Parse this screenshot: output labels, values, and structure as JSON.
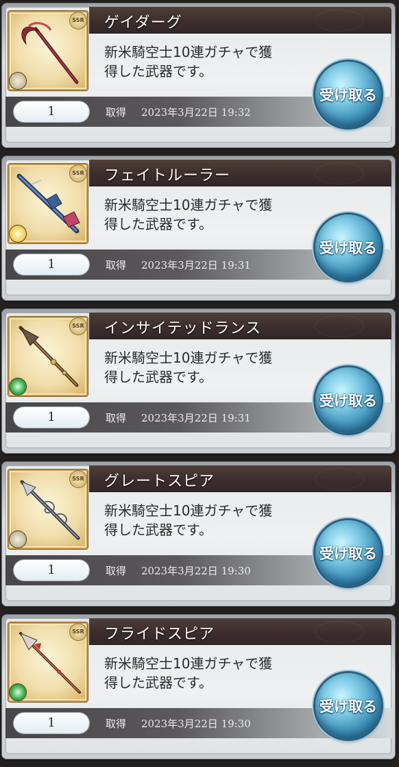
{
  "colors": {
    "title_bar": "#3b2d2a",
    "receive_button": "#3d8fb7",
    "element_dark": "#c9c0a5",
    "element_light": "#f1d25a",
    "element_wind": "#35a84a"
  },
  "items": [
    {
      "name": "ゲイダーグ",
      "description_line1": "新米騎空士10連ガチャで獲",
      "description_line2": "得した武器です。",
      "quantity": "1",
      "acquired_label": "取得",
      "acquired_date": "2023年3月22日 19:32",
      "rarity_label": "SSR",
      "element_icon": "dark-element-icon",
      "weapon_icon": "scythe-icon",
      "receive_label": "受け取る"
    },
    {
      "name": "フェイトルーラー",
      "description_line1": "新米騎空士10連ガチャで獲",
      "description_line2": "得した武器です。",
      "quantity": "1",
      "acquired_label": "取得",
      "acquired_date": "2023年3月22日 19:31",
      "rarity_label": "SSR",
      "element_icon": "light-element-icon",
      "weapon_icon": "rifle-icon",
      "receive_label": "受け取る"
    },
    {
      "name": "インサイテッドランス",
      "description_line1": "新米騎空士10連ガチャで獲",
      "description_line2": "得した武器です。",
      "quantity": "1",
      "acquired_label": "取得",
      "acquired_date": "2023年3月22日 19:31",
      "rarity_label": "SSR",
      "element_icon": "wind-element-icon",
      "weapon_icon": "lance-icon",
      "receive_label": "受け取る"
    },
    {
      "name": "グレートスピア",
      "description_line1": "新米騎空士10連ガチャで獲",
      "description_line2": "得した武器です。",
      "quantity": "1",
      "acquired_label": "取得",
      "acquired_date": "2023年3月22日 19:30",
      "rarity_label": "SSR",
      "element_icon": "dark-element-icon",
      "weapon_icon": "spear-icon",
      "receive_label": "受け取る"
    },
    {
      "name": "フライドスピア",
      "description_line1": "新米騎空士10連ガチャで獲",
      "description_line2": "得した武器です。",
      "quantity": "1",
      "acquired_label": "取得",
      "acquired_date": "2023年3月22日 19:30",
      "rarity_label": "SSR",
      "element_icon": "wind-element-icon",
      "weapon_icon": "spear-icon",
      "receive_label": "受け取る"
    }
  ]
}
